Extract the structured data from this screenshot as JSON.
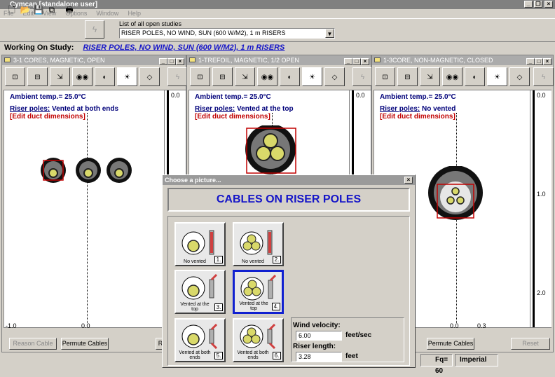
{
  "app": {
    "title": "Cymcap [standalone user]"
  },
  "menu": [
    "File",
    "Edit",
    "View",
    "Options",
    "Window",
    "Help"
  ],
  "toolbar": {
    "open_studies_label": "List of all open studies",
    "study_selected": "RISER POLES,  NO WIND, SUN (600 W/M2), 1 m RISERS"
  },
  "working": {
    "label": "Working On Study:",
    "study": "RISER POLES,  NO WIND, SUN (600 W/M2), 1 m RISERS"
  },
  "panels": [
    {
      "title": "3-1 CORES, MAGNETIC, OPEN",
      "ambient": "Ambient temp.= 25.0°C",
      "riser_label": "Riser poles:",
      "riser_value": "Vented at both ends",
      "edit": "[Edit duct dimensions]",
      "scale_top": "0.0",
      "axis_left": "-1.0",
      "axis_center": "0.0",
      "btn1": "Reason Cable",
      "btn2": "Permute Cables",
      "btn3": "R"
    },
    {
      "title": "1-TREFOIL, MAGNETIC, 1/2 OPEN",
      "ambient": "Ambient temp.= 25.0°C",
      "riser_label": "Riser poles:",
      "riser_value": "Vented at the top",
      "edit": "[Edit duct dimensions]",
      "scale_top": "0.0"
    },
    {
      "title": "1-3CORE, NON-MAGNETIC, CLOSED",
      "ambient": "Ambient temp.= 25.0°C",
      "riser_label": "Riser poles:",
      "riser_value": "No vented",
      "edit": "[Edit duct dimensions]",
      "scale_top": "0.0",
      "scale_mid": "1.0",
      "scale_bot": "2.0",
      "axis_center": "0.0",
      "axis_right": "0.3",
      "btn1": "Permute Cables",
      "btn2": "Reset"
    }
  ],
  "dialog": {
    "title": "Choose a picture...",
    "heading": "CABLES ON RISER POLES",
    "pictures": [
      {
        "label": "No vented",
        "num": "1."
      },
      {
        "label": "No vented",
        "num": "2."
      },
      {
        "label": "Vented at the top",
        "num": "3."
      },
      {
        "label": "Vented at the top",
        "num": "4."
      },
      {
        "label": "Vented at both ends",
        "num": "5."
      },
      {
        "label": "Vented at both ends",
        "num": "6."
      }
    ],
    "selected": "4.",
    "wind_label": "Wind velocity:",
    "wind_value": "6.00",
    "wind_unit": "feet/sec",
    "riser_label": "Riser length:",
    "riser_value": "3.28",
    "riser_unit": "feet"
  },
  "status": {
    "freq": "Fq= 60",
    "units": "Imperial"
  },
  "colors": {
    "accent": "#1515c8",
    "selection": "#c00000",
    "ambient_text": "#00007a",
    "cable_core": "#d9d96a"
  }
}
